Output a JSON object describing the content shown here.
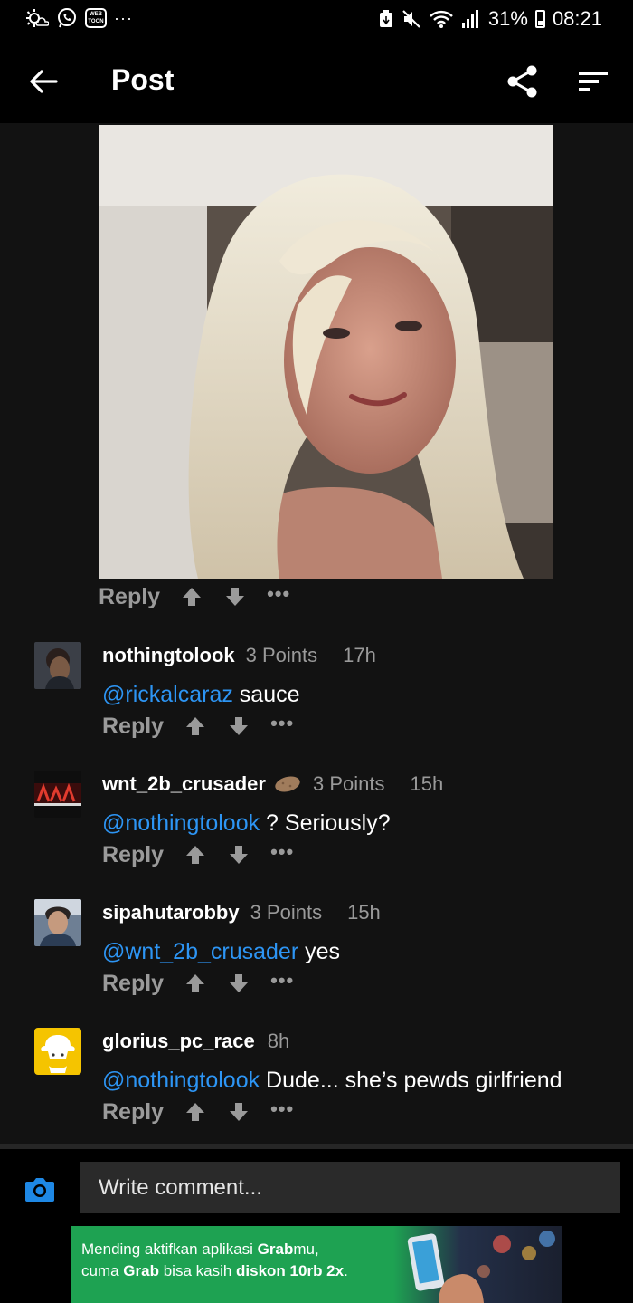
{
  "status_bar": {
    "battery": "31%",
    "time": "08:21",
    "webtoon_text": "WEB TOON",
    "icons": [
      "weather-icon",
      "whatsapp-icon",
      "webtoon-icon",
      "more-notifications-icon",
      "usb-icon",
      "mute-icon",
      "wifi-icon",
      "signal-icon",
      "battery-icon"
    ]
  },
  "app_bar": {
    "title": "Post",
    "icons": [
      "back-arrow-icon",
      "share-icon",
      "sort-icon"
    ]
  },
  "post": {
    "reply_label": "Reply",
    "more_label": "•••"
  },
  "comments": [
    {
      "username": "nothingtolook",
      "points": "3 Points",
      "time": "17h",
      "mention": "@rickalcaraz",
      "text": " sauce",
      "reply_label": "Reply",
      "more_label": "•••"
    },
    {
      "username": "wnt_2b_crusader",
      "points": "3 Points",
      "time": "15h",
      "mention": "@nothingtolook",
      "text": " ? Seriously?",
      "reply_label": "Reply",
      "more_label": "•••"
    },
    {
      "username": "sipahutarobby",
      "points": "3 Points",
      "time": "15h",
      "mention": "@wnt_2b_crusader",
      "text": " yes",
      "reply_label": "Reply",
      "more_label": "•••"
    },
    {
      "username": "glorius_pc_race",
      "points": "",
      "time": "8h",
      "mention": "@nothingtolook",
      "text": " Dude... she’s pewds girlfriend",
      "reply_label": "Reply",
      "more_label": "•••"
    }
  ],
  "composer": {
    "placeholder": "Write comment..."
  },
  "ad": {
    "line1_a": "Mending aktifkan aplikasi ",
    "line1_b": "Grab",
    "line1_c": "mu,",
    "line2_a": "cuma ",
    "line2_b": "Grab",
    "line2_c": " bisa kasih ",
    "line2_d": "diskon 10rb 2x",
    "line2_e": "."
  },
  "colors": {
    "background": "#121212",
    "bar": "#000000",
    "mention": "#2d95f4",
    "muted": "#9a9a9a",
    "ad_green": "#1ea252",
    "camera_blue": "#1e88e5"
  }
}
